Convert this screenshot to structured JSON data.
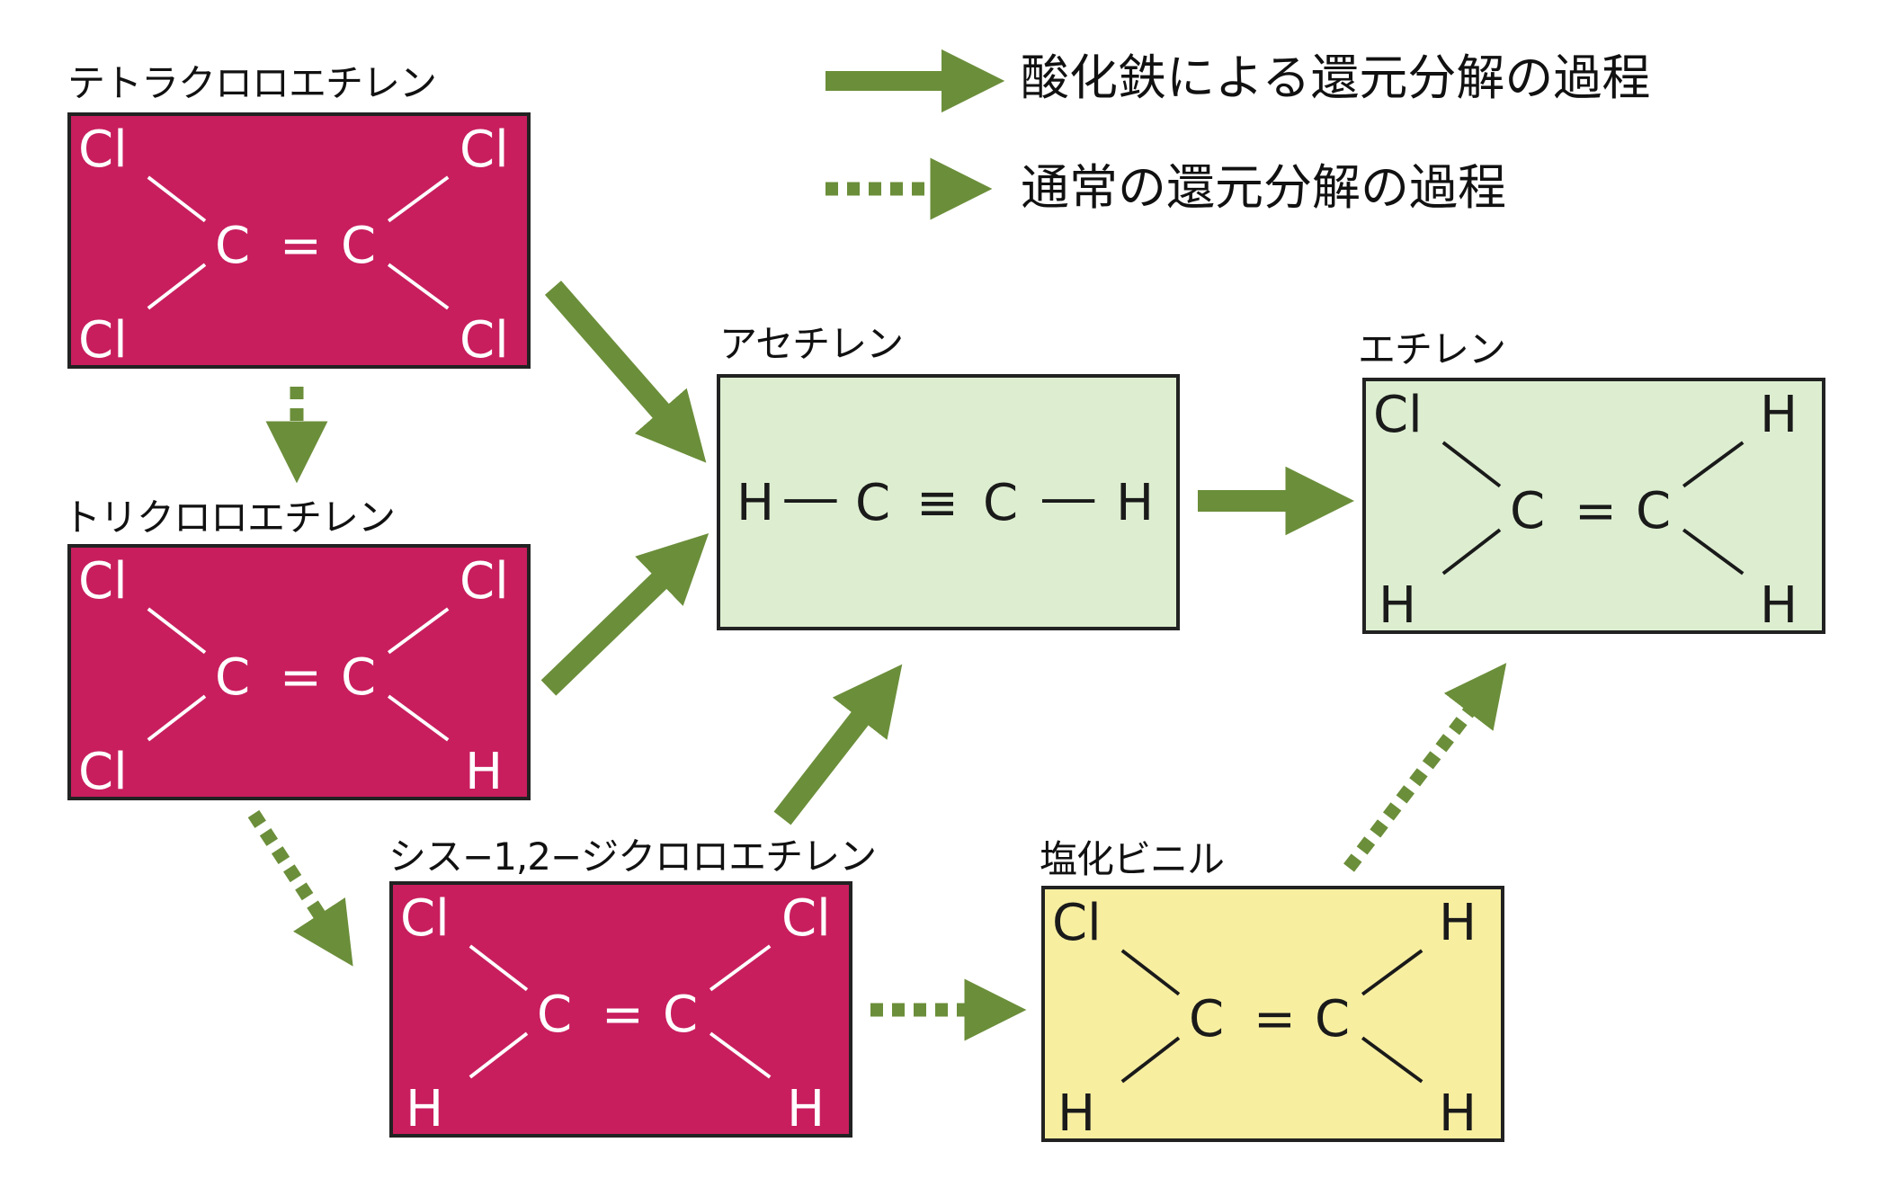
{
  "legend": {
    "solid_label": "酸化鉄による還元分解の過程",
    "dotted_label": "通常の還元分解の過程"
  },
  "colors": {
    "arrow": "#6b8e3a",
    "chlorinated_box": "#c81e5e",
    "product_box": "#ddeed0",
    "vinyl_chloride_box": "#f7eea0"
  },
  "molecules": {
    "tetrachloroethylene": {
      "name": "テトラクロロエチレン",
      "tl": "Cl",
      "tr": "Cl",
      "bl": "Cl",
      "br": "Cl",
      "c1": "C",
      "c2": "C",
      "bond": "="
    },
    "trichloroethylene": {
      "name": "トリクロロエチレン",
      "tl": "Cl",
      "tr": "Cl",
      "bl": "Cl",
      "br": "H",
      "c1": "C",
      "c2": "C",
      "bond": "="
    },
    "cis_dichloroethylene": {
      "name": "シス−1,2−ジクロロエチレン",
      "tl": "Cl",
      "tr": "Cl",
      "bl": "H",
      "br": "H",
      "c1": "C",
      "c2": "C",
      "bond": "="
    },
    "vinyl_chloride": {
      "name": "塩化ビニル",
      "tl": "Cl",
      "tr": "H",
      "bl": "H",
      "br": "H",
      "c1": "C",
      "c2": "C",
      "bond": "="
    },
    "acetylene": {
      "name": "アセチレン",
      "left": "H",
      "c1": "C",
      "c2": "C",
      "right": "H",
      "bond": "≡"
    },
    "ethylene": {
      "name": "エチレン",
      "tl": "Cl",
      "tr": "H",
      "bl": "H",
      "br": "H",
      "c1": "C",
      "c2": "C",
      "bond": "="
    }
  }
}
